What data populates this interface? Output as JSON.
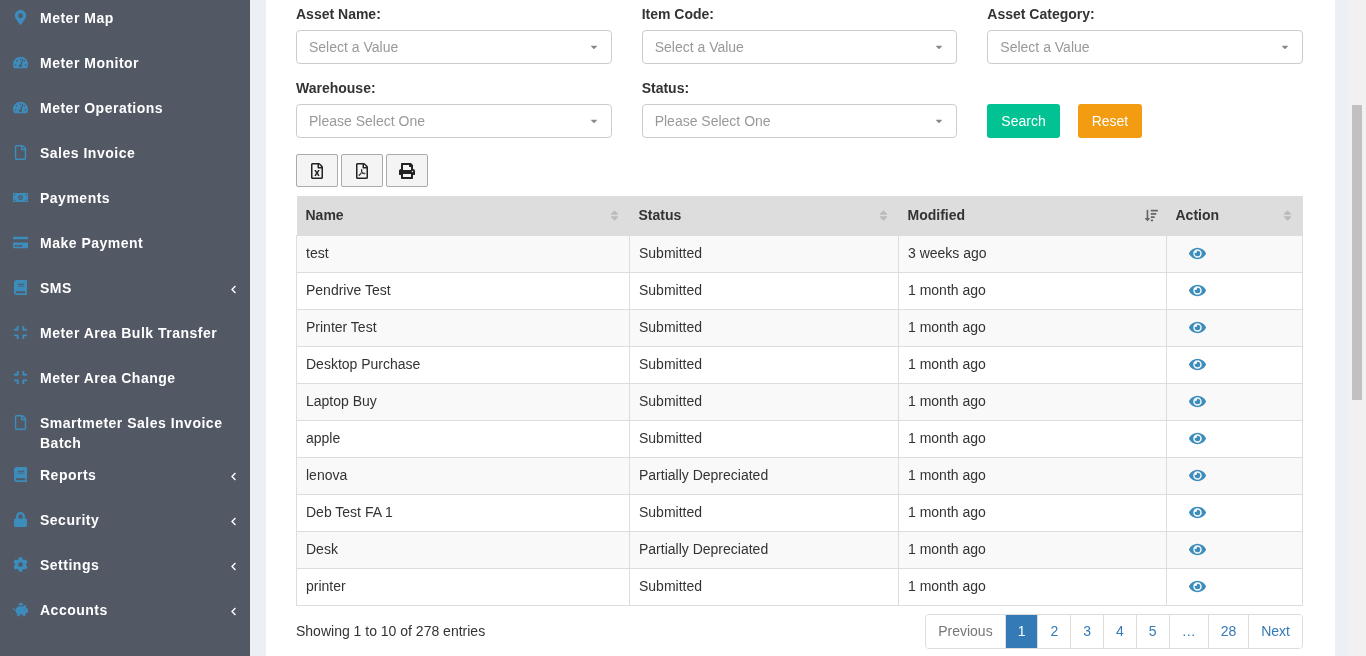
{
  "sidebar": {
    "items": [
      {
        "label": "Meter Map",
        "has_submenu": false
      },
      {
        "label": "Meter Monitor",
        "has_submenu": false
      },
      {
        "label": "Meter Operations",
        "has_submenu": false
      },
      {
        "label": "Sales Invoice",
        "has_submenu": false
      },
      {
        "label": "Payments",
        "has_submenu": false
      },
      {
        "label": "Make Payment",
        "has_submenu": false
      },
      {
        "label": "SMS",
        "has_submenu": true
      },
      {
        "label": "Meter Area Bulk Transfer",
        "has_submenu": false
      },
      {
        "label": "Meter Area Change",
        "has_submenu": false
      },
      {
        "label": "Smartmeter Sales Invoice Batch",
        "has_submenu": false
      },
      {
        "label": "Reports",
        "has_submenu": true
      },
      {
        "label": "Security",
        "has_submenu": true
      },
      {
        "label": "Settings",
        "has_submenu": true
      },
      {
        "label": "Accounts",
        "has_submenu": true
      }
    ]
  },
  "filters": [
    {
      "label": "Asset Name:",
      "placeholder": "Select a Value"
    },
    {
      "label": "Item Code:",
      "placeholder": "Select a Value"
    },
    {
      "label": "Asset Category:",
      "placeholder": "Select a Value"
    },
    {
      "label": "Warehouse:",
      "placeholder": "Please Select One"
    },
    {
      "label": "Status:",
      "placeholder": "Please Select One"
    }
  ],
  "filter_buttons": [
    {
      "label": "Search",
      "kind": "primary"
    },
    {
      "label": "Reset",
      "kind": "warning"
    }
  ],
  "table": {
    "columns": [
      {
        "label": "Name",
        "sorted": false
      },
      {
        "label": "Status",
        "sorted": false
      },
      {
        "label": "Modified",
        "sorted": true
      },
      {
        "label": "Action",
        "sorted": false
      }
    ],
    "rows": [
      [
        "test",
        "Submitted",
        "3 weeks ago"
      ],
      [
        "Pendrive Test",
        "Submitted",
        "1 month ago"
      ],
      [
        "Printer Test",
        "Submitted",
        "1 month ago"
      ],
      [
        "Desktop Purchase",
        "Submitted",
        "1 month ago"
      ],
      [
        "Laptop Buy",
        "Submitted",
        "1 month ago"
      ],
      [
        "apple",
        "Submitted",
        "1 month ago"
      ],
      [
        "lenova",
        "Partially Depreciated",
        "1 month ago"
      ],
      [
        "Deb Test FA 1",
        "Submitted",
        "1 month ago"
      ],
      [
        "Desk",
        "Partially Depreciated",
        "1 month ago"
      ],
      [
        "printer",
        "Submitted",
        "1 month ago"
      ]
    ]
  },
  "info": "Showing 1 to 10 of 278 entries",
  "pagination": [
    {
      "label": "Previous",
      "selected": false,
      "disabled": true
    },
    {
      "label": "1",
      "selected": true,
      "disabled": false
    },
    {
      "label": "2",
      "selected": false,
      "disabled": false
    },
    {
      "label": "3",
      "selected": false,
      "disabled": false
    },
    {
      "label": "4",
      "selected": false,
      "disabled": false
    },
    {
      "label": "5",
      "selected": false,
      "disabled": false
    },
    {
      "label": "…",
      "selected": false,
      "disabled": false
    },
    {
      "label": "28",
      "selected": false,
      "disabled": false
    },
    {
      "label": "Next",
      "selected": false,
      "disabled": false
    }
  ]
}
